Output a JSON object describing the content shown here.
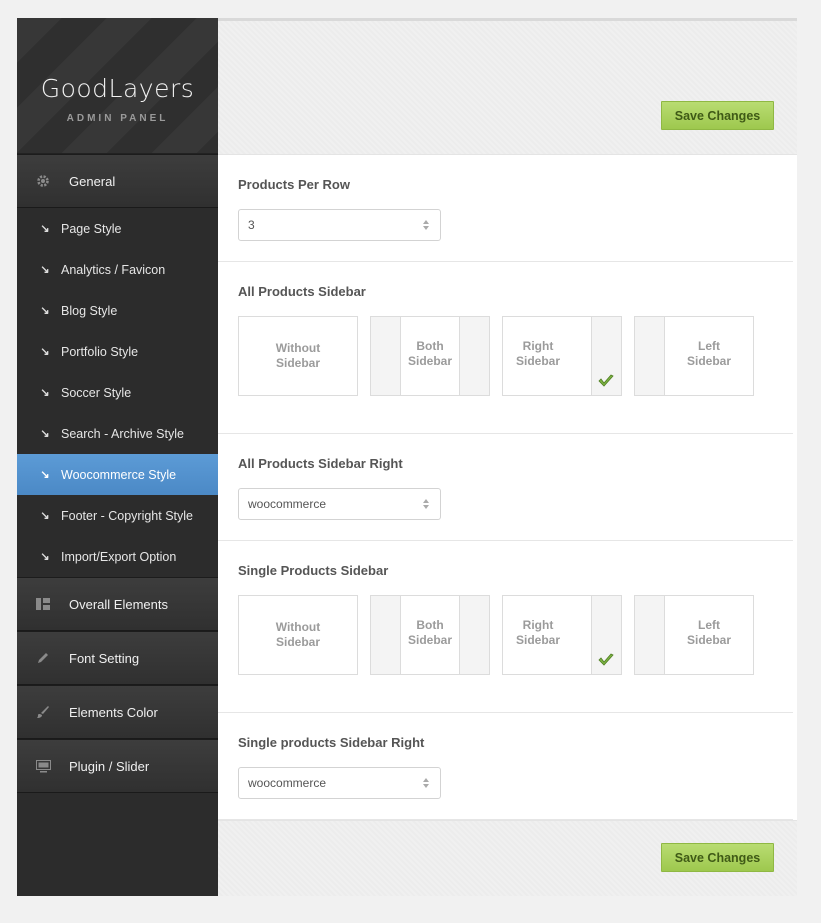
{
  "logo": {
    "title": "GoodLayers",
    "subtitle": "ADMIN PANEL"
  },
  "menu": {
    "general": "General",
    "sub_items": [
      "Page Style",
      "Analytics / Favicon",
      "Blog Style",
      "Portfolio Style",
      "Soccer Style",
      "Search - Archive Style",
      "Woocommerce Style",
      "Footer - Copyright Style",
      "Import/Export Option"
    ],
    "active_item": "Woocommerce Style",
    "overall_elements": "Overall Elements",
    "font_setting": "Font Setting",
    "elements_color": "Elements Color",
    "plugin_slider": "Plugin / Slider"
  },
  "buttons": {
    "save_top": "Save Changes",
    "save_bottom": "Save Changes"
  },
  "products_per_row": {
    "title": "Products Per Row",
    "value": "3"
  },
  "all_products_sidebar": {
    "title": "All Products Sidebar",
    "options": [
      {
        "line1": "Without",
        "line2": "Sidebar"
      },
      {
        "line1": "Both",
        "line2": "Sidebar"
      },
      {
        "line1": "Right",
        "line2": "Sidebar"
      },
      {
        "line1": "Left",
        "line2": "Sidebar"
      }
    ],
    "selected": "Right Sidebar"
  },
  "all_products_sidebar_right": {
    "title": "All Products Sidebar Right",
    "value": "woocommerce"
  },
  "single_products_sidebar": {
    "title": "Single Products Sidebar",
    "options": [
      {
        "line1": "Without",
        "line2": "Sidebar"
      },
      {
        "line1": "Both",
        "line2": "Sidebar"
      },
      {
        "line1": "Right",
        "line2": "Sidebar"
      },
      {
        "line1": "Left",
        "line2": "Sidebar"
      }
    ],
    "selected": "Right Sidebar"
  },
  "single_products_sidebar_right": {
    "title": "Single products Sidebar Right",
    "value": "woocommerce"
  },
  "colors": {
    "accent": "#5c9bd6",
    "save_button": "#aed25f",
    "sidebar_bg": "#2c2c2c"
  }
}
